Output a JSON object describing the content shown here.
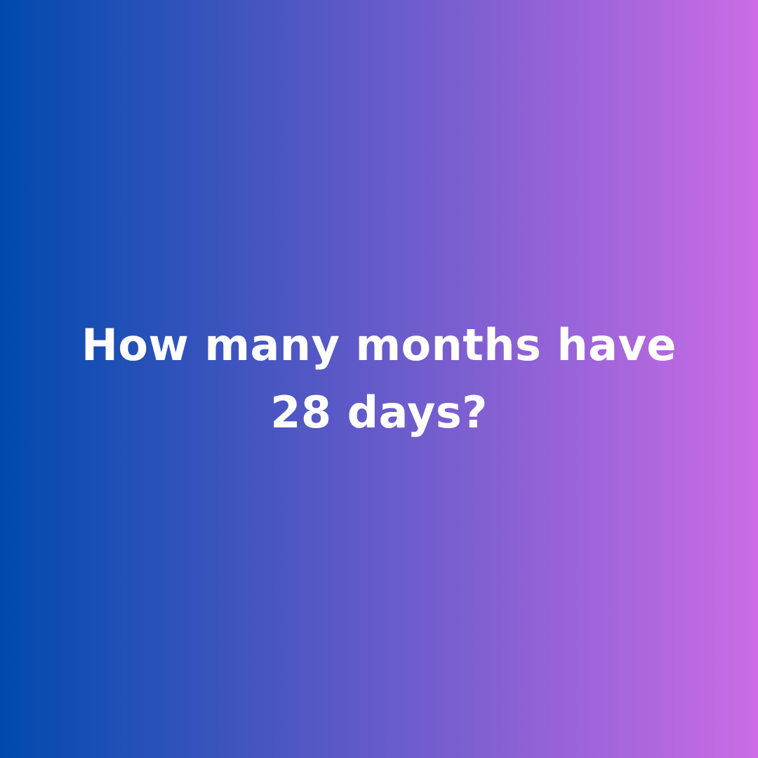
{
  "question": {
    "line1": "How many months have",
    "line2": "28 days?"
  },
  "colors": {
    "gradient_start": "#004aad",
    "gradient_end": "#cb6ce6",
    "text": "#ffffff"
  }
}
